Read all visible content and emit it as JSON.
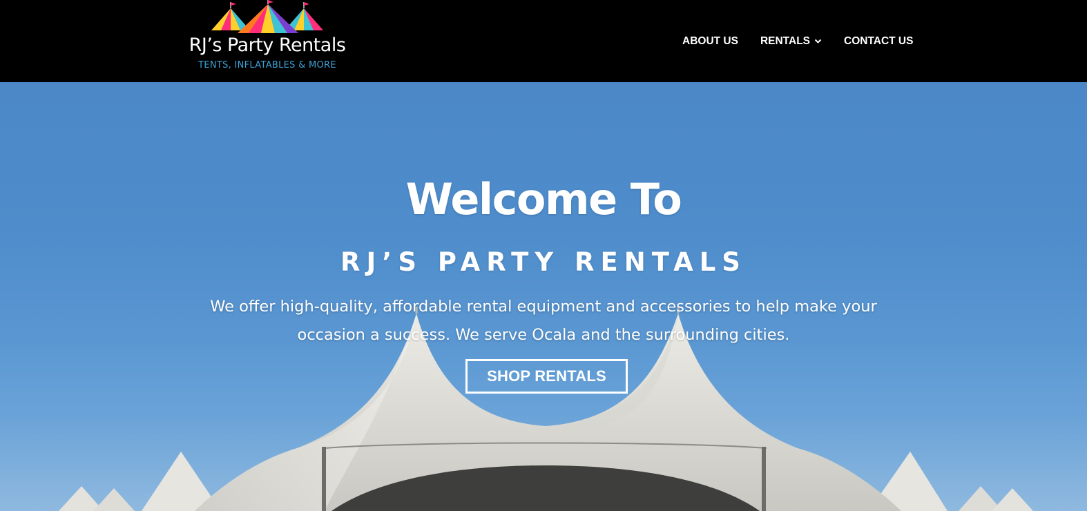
{
  "logo": {
    "title": "RJ’s Party Rentals",
    "tagline": "TENTS, INFLATABLES & MORE",
    "colors": [
      "#ff2d7a",
      "#3ec2d6",
      "#ffd02a",
      "#ff7a1f",
      "#7a3fd1"
    ]
  },
  "nav": {
    "about": "ABOUT US",
    "rentals": "RENTALS",
    "contact": "CONTACT US"
  },
  "hero": {
    "heading": "Welcome To",
    "brand": "RJ’S PARTY RENTALS",
    "line1": "We offer high-quality, affordable rental equipment and accessories to help make your",
    "line2": "occasion a success. We serve Ocala and the surrounding cities.",
    "cta": "SHOP RENTALS"
  },
  "theme": {
    "header_bg": "#000000",
    "sky": "#4c88c8",
    "tent": "#e9e7e2",
    "accent": "#3ea3d8"
  }
}
